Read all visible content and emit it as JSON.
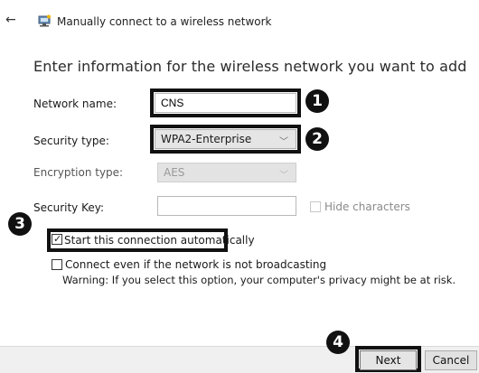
{
  "window": {
    "title": "Manually connect to a wireless network",
    "back_icon": "back-arrow-icon",
    "app_icon": "network-icon"
  },
  "heading": "Enter information for the wireless network you want to add",
  "fields": {
    "network_name": {
      "label": "Network name:",
      "value": "CNS"
    },
    "security_type": {
      "label": "Security type:",
      "value": "WPA2-Enterprise"
    },
    "encryption_type": {
      "label": "Encryption type:",
      "value": "AES"
    },
    "security_key": {
      "label": "Security Key:",
      "value": "",
      "hide_label": "Hide characters"
    }
  },
  "options": {
    "auto_connect": {
      "label": "Start this connection automatically",
      "checked": true
    },
    "connect_hidden": {
      "label": "Connect even if the network is not broadcasting",
      "checked": false
    },
    "warning": "Warning: If you select this option, your computer's privacy might be at risk."
  },
  "buttons": {
    "next": "Next",
    "cancel": "Cancel"
  },
  "markers": [
    "1",
    "2",
    "3",
    "4"
  ],
  "colors": {
    "outline": "#111111",
    "footer": "#f0f0f0"
  }
}
